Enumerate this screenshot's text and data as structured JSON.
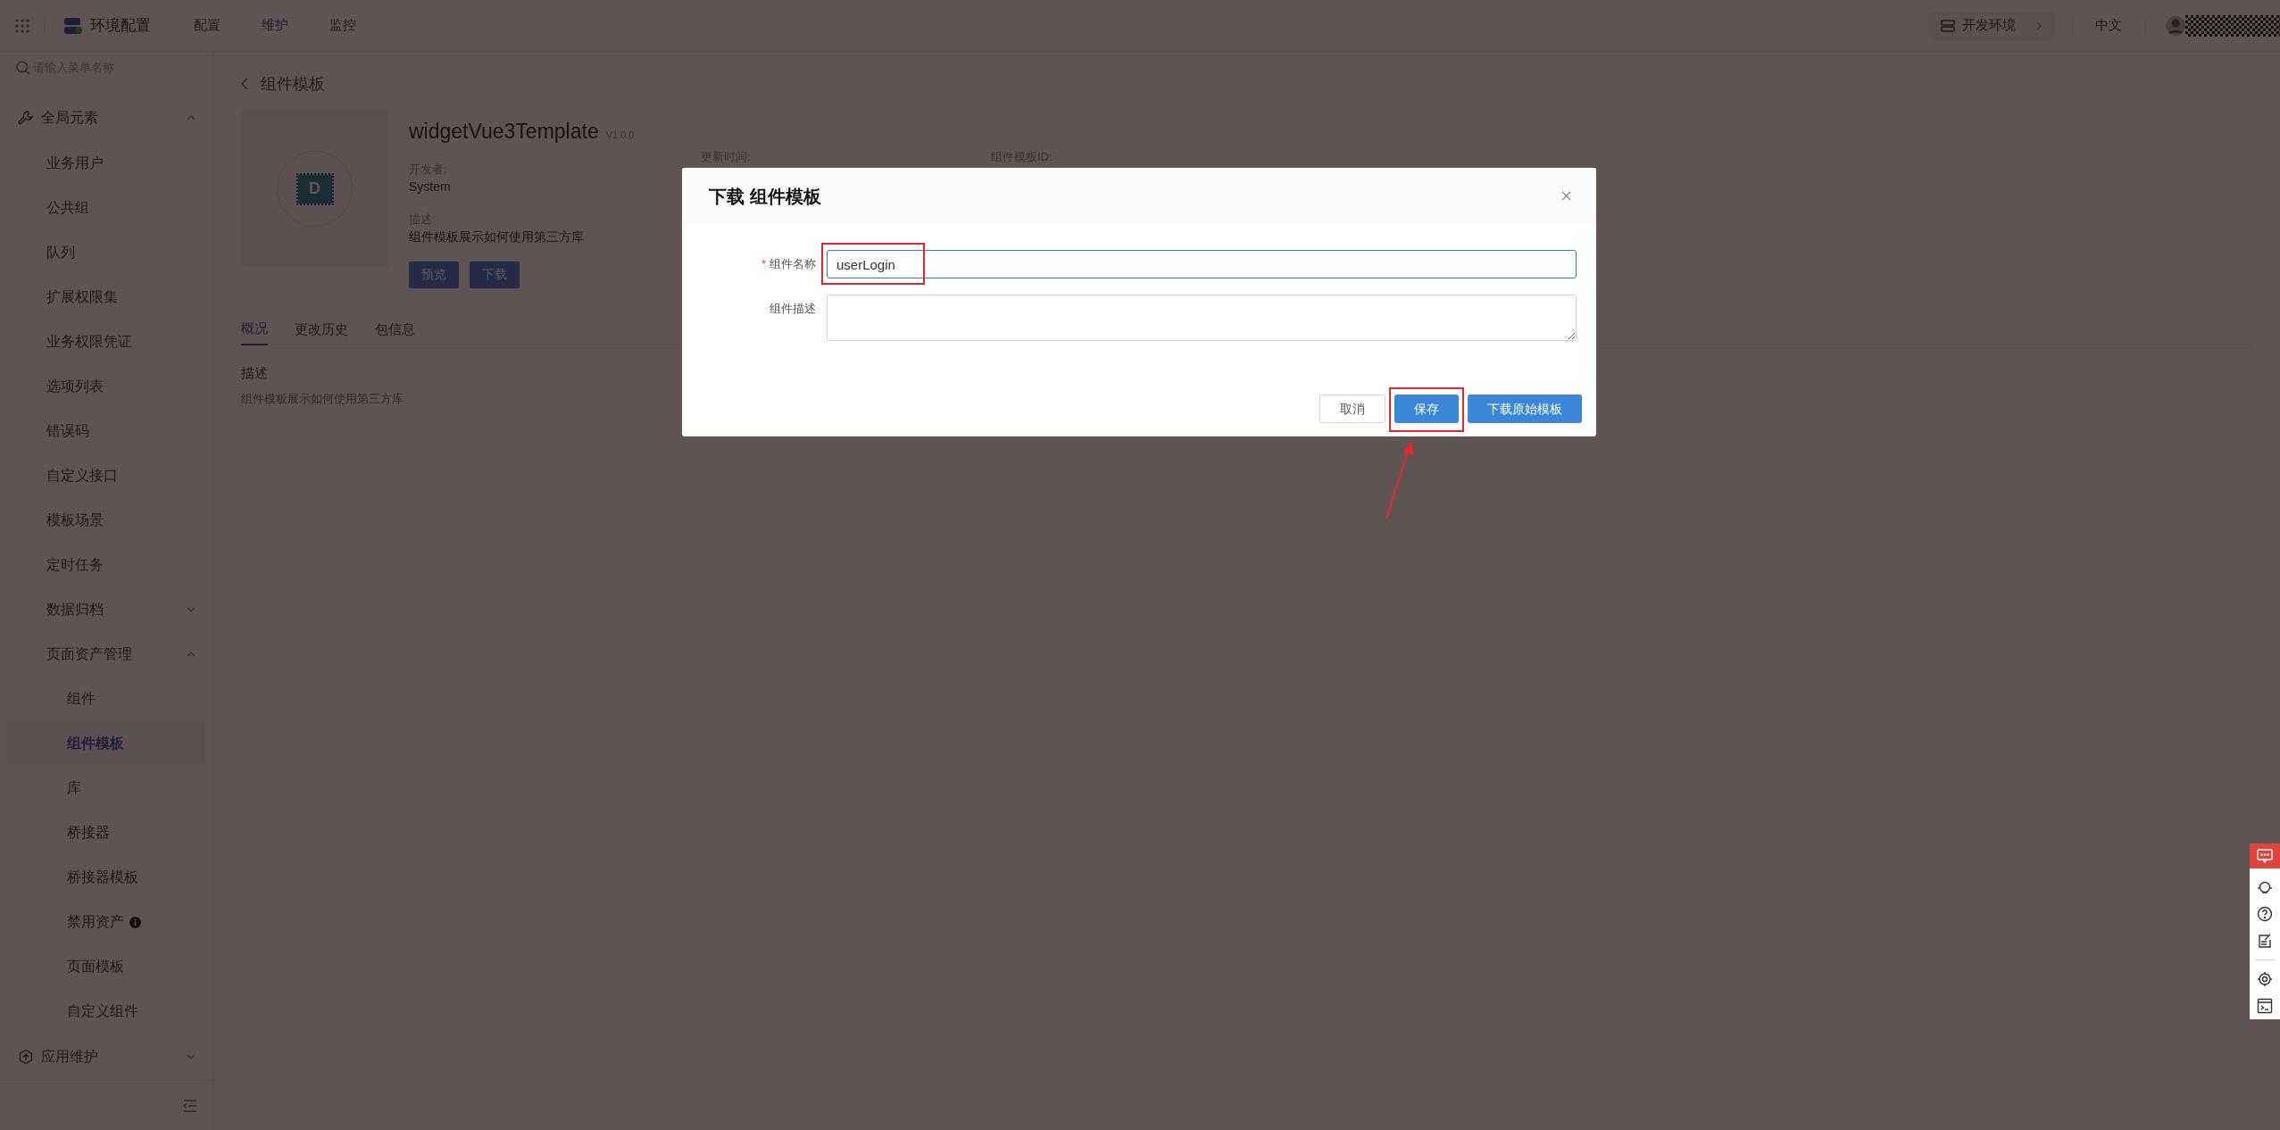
{
  "top_bar": {
    "app_title": "环境配置",
    "nav": [
      {
        "label": "配置",
        "selected": false
      },
      {
        "label": "维护",
        "selected": true
      },
      {
        "label": "监控",
        "selected": false
      }
    ],
    "environment": "开发环境",
    "language": "中文"
  },
  "sidebar": {
    "search_placeholder": "请输入菜单名称",
    "groups": [
      {
        "label": "全局元素",
        "expanded": true,
        "children": [
          {
            "label": "业务用户",
            "selected": false
          },
          {
            "label": "公共组",
            "selected": false
          },
          {
            "label": "队列",
            "selected": false
          },
          {
            "label": "扩展权限集",
            "selected": false
          },
          {
            "label": "业务权限凭证",
            "selected": false
          },
          {
            "label": "选项列表",
            "selected": false
          },
          {
            "label": "错误码",
            "selected": false
          },
          {
            "label": "自定义接口",
            "selected": false
          },
          {
            "label": "模板场景",
            "selected": false
          },
          {
            "label": "定时任务",
            "selected": false
          },
          {
            "label": "数据归档",
            "selected": false,
            "expanded": false
          },
          {
            "label": "页面资产管理",
            "selected": false,
            "expanded": true,
            "children": [
              {
                "label": "组件",
                "selected": false
              },
              {
                "label": "组件模板",
                "selected": true
              },
              {
                "label": "库",
                "selected": false
              },
              {
                "label": "桥接器",
                "selected": false
              },
              {
                "label": "桥接器模板",
                "selected": false
              },
              {
                "label": "禁用资产",
                "selected": false,
                "info": true
              },
              {
                "label": "页面模板",
                "selected": false
              },
              {
                "label": "自定义组件",
                "selected": false
              }
            ]
          }
        ]
      },
      {
        "label": "应用维护",
        "expanded": false
      }
    ]
  },
  "main": {
    "page_title": "组件模板",
    "template": {
      "icon_letter": "D",
      "name": "widgetVue3Template",
      "version": "V1.0.0",
      "fields": [
        {
          "label": "开发者:",
          "value": "System"
        },
        {
          "label": "描述",
          "value": "组件模板展示如何使用第三方库"
        }
      ],
      "meta_labels": [
        "更新时间:",
        "组件模板ID:"
      ],
      "buttons": [
        "预览",
        "下载"
      ]
    },
    "tabs": [
      {
        "label": "概况",
        "selected": true
      },
      {
        "label": "更改历史",
        "selected": false
      },
      {
        "label": "包信息",
        "selected": false
      }
    ],
    "section": {
      "title": "描述",
      "text": "组件模板展示如何使用第三方库"
    }
  },
  "dialog": {
    "title": "下载 组件模板",
    "required_mark": "*",
    "fields": [
      {
        "kind": "input",
        "label": "组件名称",
        "required": true,
        "value": "userLogin",
        "highlighted": true
      },
      {
        "kind": "textarea",
        "label": "组件描述",
        "required": false,
        "highlighted": false
      }
    ],
    "buttons": [
      {
        "kind": "default",
        "label": "取消",
        "highlighted": false
      },
      {
        "kind": "primary",
        "label": "保存",
        "highlighted": true
      },
      {
        "kind": "primary",
        "label": "下载原始模板",
        "highlighted": false
      }
    ]
  }
}
